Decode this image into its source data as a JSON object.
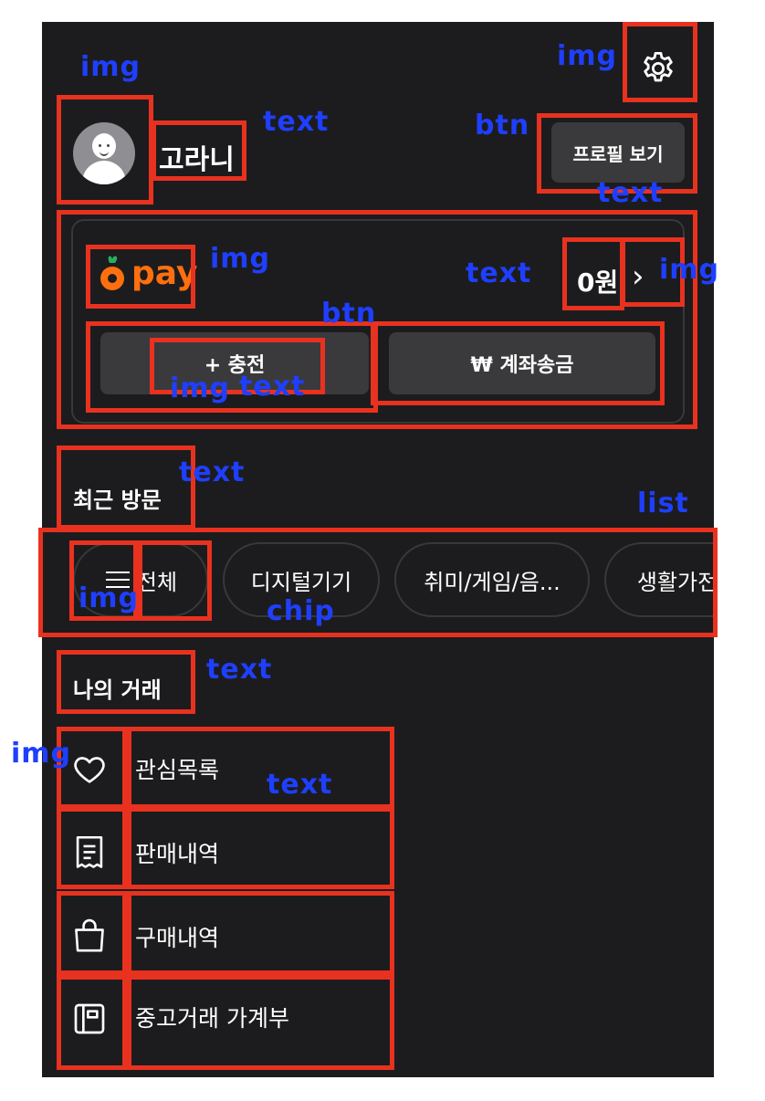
{
  "header": {
    "username": "고라니",
    "profile_button": "프로필 보기"
  },
  "pay": {
    "logo_text": "pay",
    "balance": "0원",
    "charge_label": "+ 충전",
    "transfer_label": "₩ 계좌송금",
    "brand_color": "#ff6f0f"
  },
  "recent": {
    "title": "최근 방문",
    "chips": [
      {
        "label": "전체"
      },
      {
        "label": "디지털기기"
      },
      {
        "label": "취미/게임/음..."
      },
      {
        "label": "생활가전"
      }
    ]
  },
  "transactions": {
    "title": "나의 거래",
    "items": [
      {
        "label": "관심목록",
        "icon": "heart-icon"
      },
      {
        "label": "판매내역",
        "icon": "receipt-icon"
      },
      {
        "label": "구매내역",
        "icon": "shopping-bag-icon"
      },
      {
        "label": "중고거래 가계부",
        "icon": "ledger-icon"
      }
    ]
  },
  "annotations": {
    "img": "img",
    "text": "text",
    "btn": "btn",
    "list": "list",
    "chip": "chip"
  },
  "colors": {
    "background": "#1c1c1e",
    "surface": "#3a3a3c",
    "annotation_box": "#e8321f",
    "annotation_label": "#1f3fff"
  }
}
